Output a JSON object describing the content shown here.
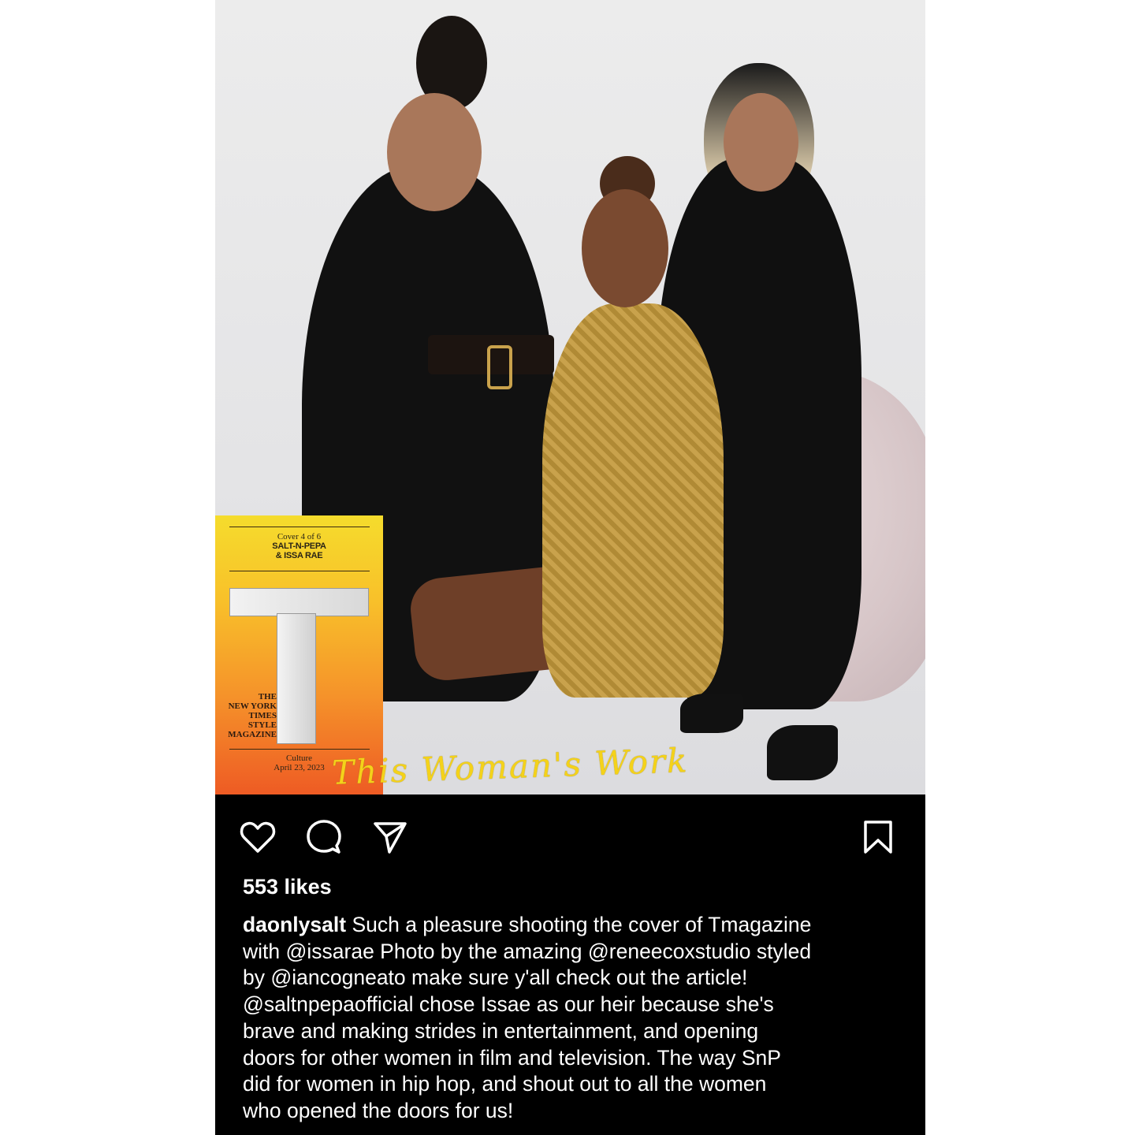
{
  "cover": {
    "meta_top": [
      "Cover 4 of 6",
      "SALT-N-PEPA",
      "& ISSA RAE"
    ],
    "masthead": [
      "THE",
      "NEW YORK",
      "TIMES",
      "STYLE",
      "MAGAZINE"
    ],
    "meta_bottom": [
      "Culture",
      "April 23, 2023"
    ],
    "headline": "This Woman's Work"
  },
  "actions": {
    "like_icon": "heart-icon",
    "comment_icon": "comment-icon",
    "share_icon": "paper-plane-icon",
    "save_icon": "bookmark-icon"
  },
  "post": {
    "likes": "553 likes",
    "username": "daonlysalt",
    "caption_lines": [
      " Such a pleasure shooting the cover of Tmagazine",
      "with @issarae Photo  by the amazing @reneecoxstudio styled",
      "by @iancogneato make sure y'all check out the article!",
      "@saltnpepaofficial chose Issae as our heir because she's",
      "brave and making strides in entertainment, and opening",
      "doors for other women in film and television. The way SnP",
      "did for women in hip hop, and shout out to all the women",
      "who opened the doors for us!"
    ]
  }
}
